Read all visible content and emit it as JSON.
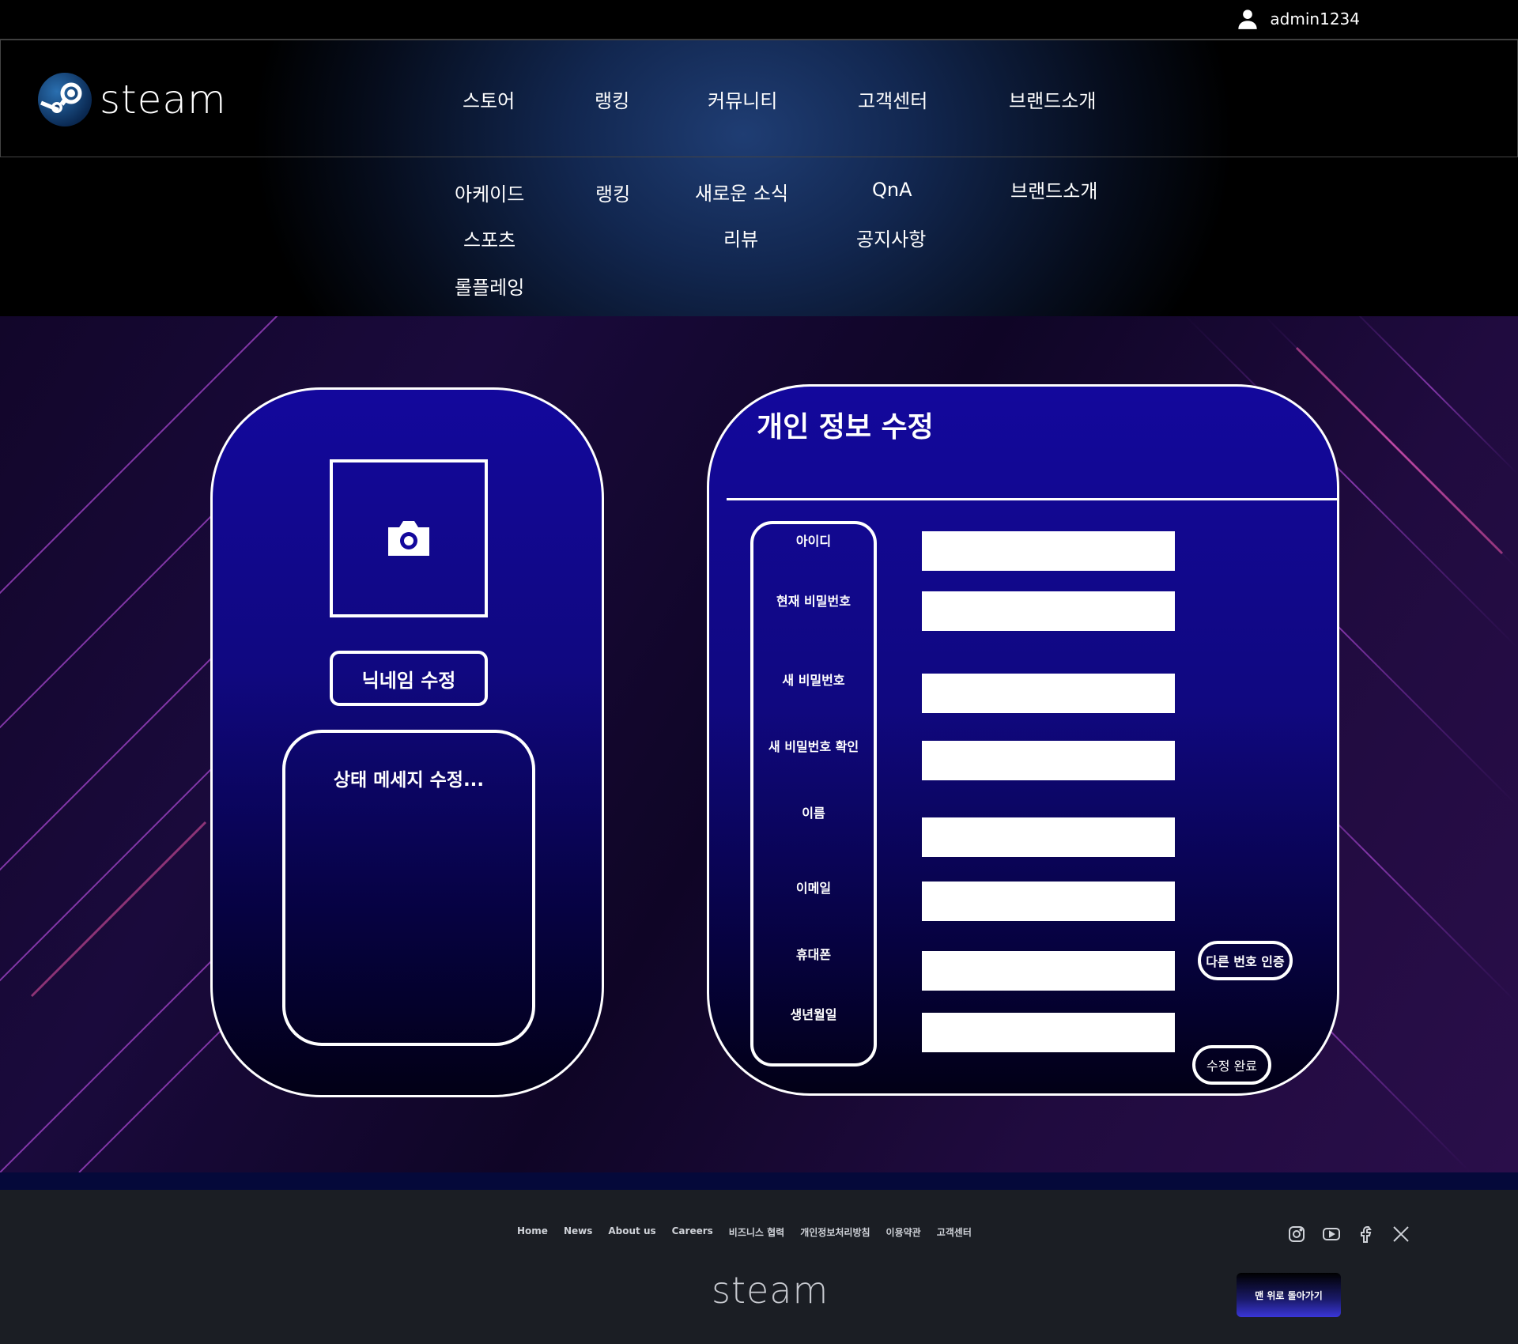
{
  "user": {
    "name": "admin1234"
  },
  "brand": {
    "logo_text": "steam"
  },
  "nav": {
    "store": "스토어",
    "ranking": "랭킹",
    "community": "커뮤니티",
    "support": "고객센터",
    "brand": "브랜드소개"
  },
  "submenu": {
    "store": [
      "아케이드",
      "스포츠",
      "롤플레잉"
    ],
    "ranking": [
      "랭킹"
    ],
    "community": [
      "새로운 소식",
      "리뷰"
    ],
    "support": [
      "QnA",
      "공지사항"
    ],
    "brand": [
      "브랜드소개"
    ]
  },
  "profile": {
    "nickname_button": "닉네임 수정",
    "status_placeholder": "상태 메세지 수정..."
  },
  "form": {
    "title": "개인 정보 수정",
    "labels": [
      "아이디",
      "현재 비밀번호",
      "새 비밀번호",
      "새 비밀번호 확인",
      "이름",
      "이메일",
      "휴대폰",
      "생년월일"
    ],
    "other_phone_button": "다른 번호 인증",
    "submit_button": "수정 완료"
  },
  "footer": {
    "links": [
      "Home",
      "News",
      "About us",
      "Careers",
      "비즈니스 협력",
      "개인정보처리방침",
      "이용약관",
      "고객센터"
    ],
    "logo_text": "steam",
    "top_button": "맨 위로 돌아가기"
  },
  "icons": {
    "user": "user-icon",
    "camera": "camera-icon",
    "instagram": "instagram-icon",
    "youtube": "youtube-icon",
    "facebook": "facebook-icon",
    "x": "x-icon"
  },
  "colors": {
    "card_top": "#13089c",
    "card_bottom": "#020016",
    "footer_bg": "#1b1e24",
    "header_glow": "#1f3d73"
  }
}
